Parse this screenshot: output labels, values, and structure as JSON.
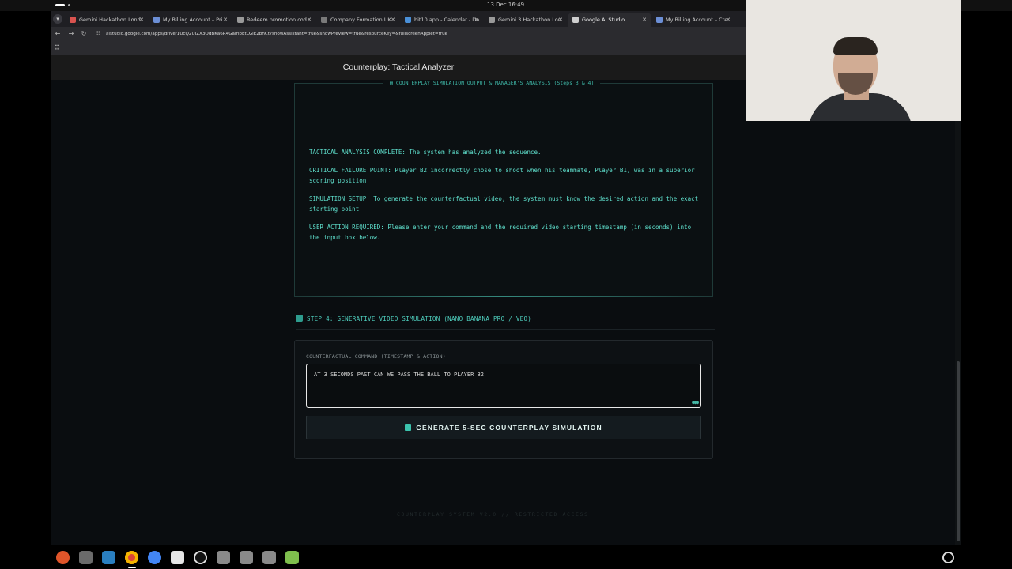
{
  "os": {
    "clock": "13 Dec 16:49"
  },
  "browser": {
    "tabs": [
      {
        "label": "Gemini Hackathon Lond",
        "icon": "gemini-favicon",
        "active": false
      },
      {
        "label": "My Billing Account – Pri",
        "icon": "google-favicon",
        "active": false
      },
      {
        "label": "Redeem promotion cod",
        "icon": "google-favicon",
        "active": false
      },
      {
        "label": "Company Formation UK",
        "icon": "site-favicon",
        "active": false
      },
      {
        "label": "bit10.app - Calendar - Da",
        "icon": "calendar-favicon",
        "active": false
      },
      {
        "label": "Gemini 3 Hackathon Lon",
        "icon": "gemini-favicon",
        "active": false
      },
      {
        "label": "Google AI Studio",
        "icon": "ai-studio-favicon",
        "active": true
      },
      {
        "label": "My Billing Account – Cre",
        "icon": "google-favicon",
        "active": false
      }
    ],
    "url": "aistudio.google.com/apps/drive/1UcQ2UIZX3OdBKa6R4GambEtLGlE2bnCt?showAssistant=true&showPreview=true&resourceKey=&fullscreenApplet=true"
  },
  "app": {
    "title": "Counterplay: Tactical Analyzer",
    "analysis_panel": {
      "legend": "COUNTERPLAY SIMULATION OUTPUT & MANAGER'S ANALYSIS (Steps 3 & 4)",
      "paragraphs": {
        "p1": "TACTICAL ANALYSIS COMPLETE: The system has analyzed the sequence.",
        "p2": "CRITICAL FAILURE POINT: Player B2 incorrectly chose to shoot when his teammate, Player B1, was in a superior scoring position.",
        "p3": "SIMULATION SETUP: To generate the counterfactual video, the system must know the desired action and the exact starting point.",
        "p4": "USER ACTION REQUIRED: Please enter your command and the required video starting timestamp (in seconds) into the input box below."
      }
    },
    "step4": {
      "header": "STEP 4: GENERATIVE VIDEO SIMULATION (NANO BANANA PRO / VEO)",
      "command_label": "COUNTERFACTUAL COMMAND (TIMESTAMP & ACTION)",
      "command_value": "AT 3 SECONDS PAST CAN WE PASS THE BALL TO PLAYER B2",
      "generate_button": "GENERATE 5-SEC COUNTERPLAY SIMULATION"
    },
    "footer": "COUNTERPLAY SYSTEM V2.0 // RESTRICTED ACCESS"
  },
  "taskbar": {
    "apps": [
      "firefox-icon",
      "files-icon",
      "text-editor-icon",
      "chrome-icon",
      "chrome-dev-icon",
      "notes-icon",
      "obs-icon",
      "drive-icon",
      "drive-icon",
      "drive-icon",
      "trash-icon"
    ]
  },
  "colors": {
    "accent": "#5fe0cd",
    "background": "#0a0d10"
  }
}
